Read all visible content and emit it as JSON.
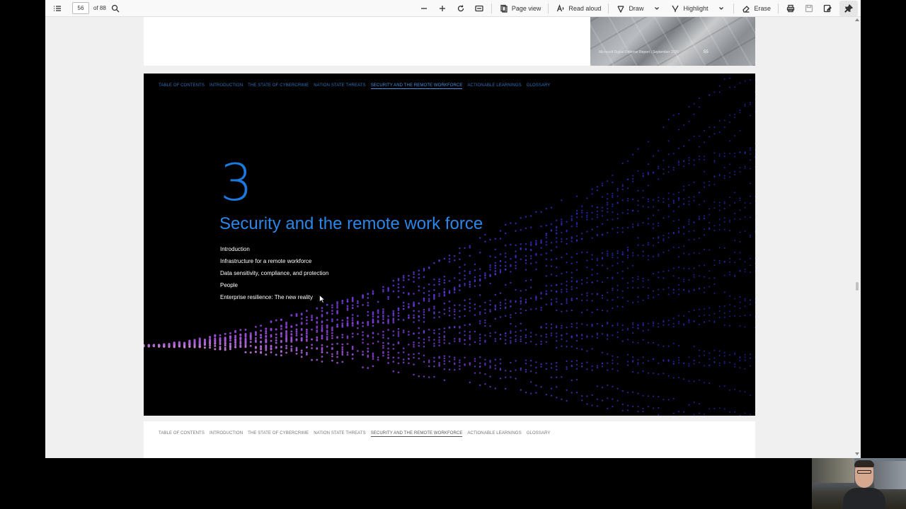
{
  "toolbar": {
    "page_current": "56",
    "page_of": "of 88",
    "page_view_label": "Page view",
    "read_aloud_label": "Read aloud",
    "draw_label": "Draw",
    "highlight_label": "Highlight",
    "erase_label": "Erase"
  },
  "prev_page": {
    "footer_text": "Microsoft Digital Defense Report | September 2020",
    "page_number": "55"
  },
  "nav": {
    "items": [
      "TABLE OF CONTENTS",
      "INTRODUCTION",
      "THE STATE OF CYBERCRIME",
      "NATION STATE THREATS",
      "SECURITY AND THE REMOTE WORKFORCE",
      "ACTIONABLE LEARNINGS",
      "GLOSSARY"
    ],
    "active_index": 4
  },
  "chapter": {
    "number": "3",
    "title": "Security and the remote work force",
    "sections": [
      "Introduction",
      "Infrastructure for a remote workforce",
      "Data sensitivity, compliance, and protection",
      "People",
      "Enterprise resilience: The new reality"
    ]
  },
  "colors": {
    "accent_blue": "#2a86e8",
    "wave_pink": "#e0a0d8",
    "wave_purple": "#8a3fd0",
    "wave_blue": "#3030e0"
  }
}
